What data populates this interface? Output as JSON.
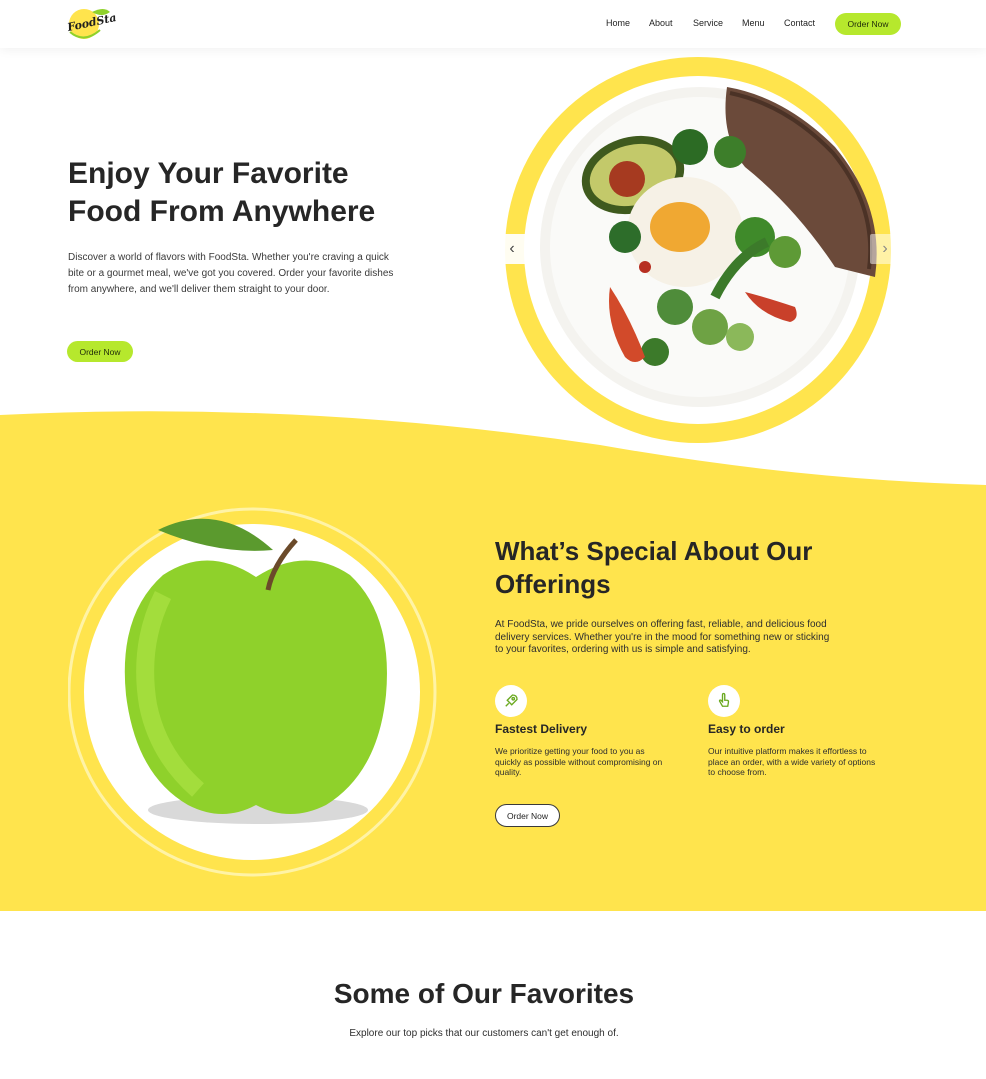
{
  "brand": {
    "name": "FoodSta"
  },
  "nav": {
    "items": [
      "Home",
      "About",
      "Service",
      "Menu",
      "Contact"
    ],
    "cta": "Order Now"
  },
  "hero": {
    "title_line1": "Enjoy Your Favorite",
    "title_line2": "Food From Anywhere",
    "description": "Discover a world of flavors with FoodSta. Whether you're craving a quick bite or a gourmet meal, we've got you covered. Order your favorite dishes from anywhere, and we'll deliver them straight to your door.",
    "cta": "Order Now",
    "prev_icon": "chevron-left-icon",
    "next_icon": "chevron-right-icon"
  },
  "special": {
    "title_line1": "What’s Special About Our",
    "title_line2": "Offerings",
    "description": "At FoodSta, we pride ourselves on offering fast, reliable, and delicious food delivery services. Whether you're in the mood for something new or sticking to your favorites, ordering with us is simple and satisfying.",
    "features": [
      {
        "icon": "rocket-icon",
        "title": "Fastest Delivery",
        "description": "We prioritize getting your food to you as quickly as possible without compromising on quality."
      },
      {
        "icon": "tap-icon",
        "title": "Easy to order",
        "description": "Our intuitive platform makes it effortless to place an order, with a wide variety of options to choose from."
      }
    ],
    "cta": "Order Now"
  },
  "favorites": {
    "title": "Some of Our Favorites",
    "subtitle": "Explore our top picks that our customers can't get enough of."
  },
  "colors": {
    "accent_green": "#b6e82d",
    "yellow": "#ffe44d",
    "text_dark": "#262626"
  }
}
